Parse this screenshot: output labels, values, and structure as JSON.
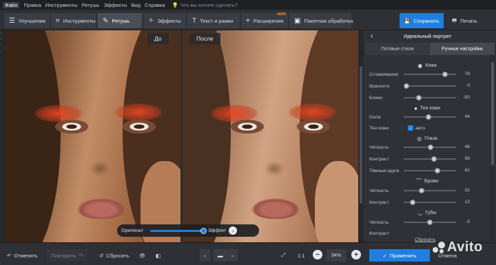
{
  "menu": {
    "items": [
      "Файл",
      "Правка",
      "Инструменты",
      "Ретушь",
      "Эффекты",
      "Вид",
      "Справка"
    ],
    "search_placeholder": "Что вы хотите сделать?"
  },
  "toolbar": {
    "tabs": [
      "Улучшения",
      "Инструменты",
      "Ретушь",
      "Эффекты",
      "Текст и рамки",
      "Расширения",
      "Пакетная обработка"
    ],
    "new_badge": "NEW",
    "save_label": "Сохранить",
    "print_label": "Печать"
  },
  "canvas": {
    "before_label": "До",
    "after_label": "После",
    "compare": {
      "left_label": "Оригинал",
      "right_label": "Эффект",
      "value": 1.0
    }
  },
  "panel": {
    "title": "Идеальный портрет",
    "tabs": [
      "Готовые стили",
      "Ручные настройки"
    ],
    "sections": {
      "skin": "Кожа",
      "tone": "Тон кожи",
      "eyes": "Глаза",
      "brows": "Брови",
      "lips": "Губы"
    },
    "sliders": {
      "smoothing": {
        "label": "Сглаживание",
        "value": "78",
        "pos": 0.78
      },
      "redness": {
        "label": "Краснота",
        "value": "0",
        "pos": 0.0
      },
      "glare": {
        "label": "Блики",
        "value": "-50",
        "pos": 0.25
      },
      "strength": {
        "label": "Сила",
        "value": "44",
        "pos": 0.44
      },
      "eyes_sharp": {
        "label": "Чёткость",
        "value": "48",
        "pos": 0.48
      },
      "eyes_contrast": {
        "label": "Контраст",
        "value": "56",
        "pos": 0.56
      },
      "dark_circles": {
        "label": "Тёмные круги",
        "value": "62",
        "pos": 0.62
      },
      "brows_sharp": {
        "label": "Чёткость",
        "value": "31",
        "pos": 0.31
      },
      "brows_contrast": {
        "label": "Контраст",
        "value": "12",
        "pos": 0.12
      },
      "lips_sharp": {
        "label": "Чёткость",
        "value": "-5",
        "pos": 0.475
      },
      "lips_contrast": {
        "label": "Контраст",
        "value": "",
        "pos": 0.5
      }
    },
    "skin_tone": {
      "label": "Тон кожи",
      "auto_label": "авто",
      "checked": true
    },
    "reset_link": "Сбросить"
  },
  "bottom": {
    "undo": "Отменить",
    "redo": "Повторить",
    "reset": "Сбросить",
    "one_to_one": "1:1",
    "zoom": "94%",
    "apply": "Применить",
    "cancel": "Отмена"
  },
  "watermark": "Avito",
  "colors": {
    "accent": "#1e7fe0",
    "new_badge": "#ff8a2a",
    "background": "#2b2d31"
  }
}
